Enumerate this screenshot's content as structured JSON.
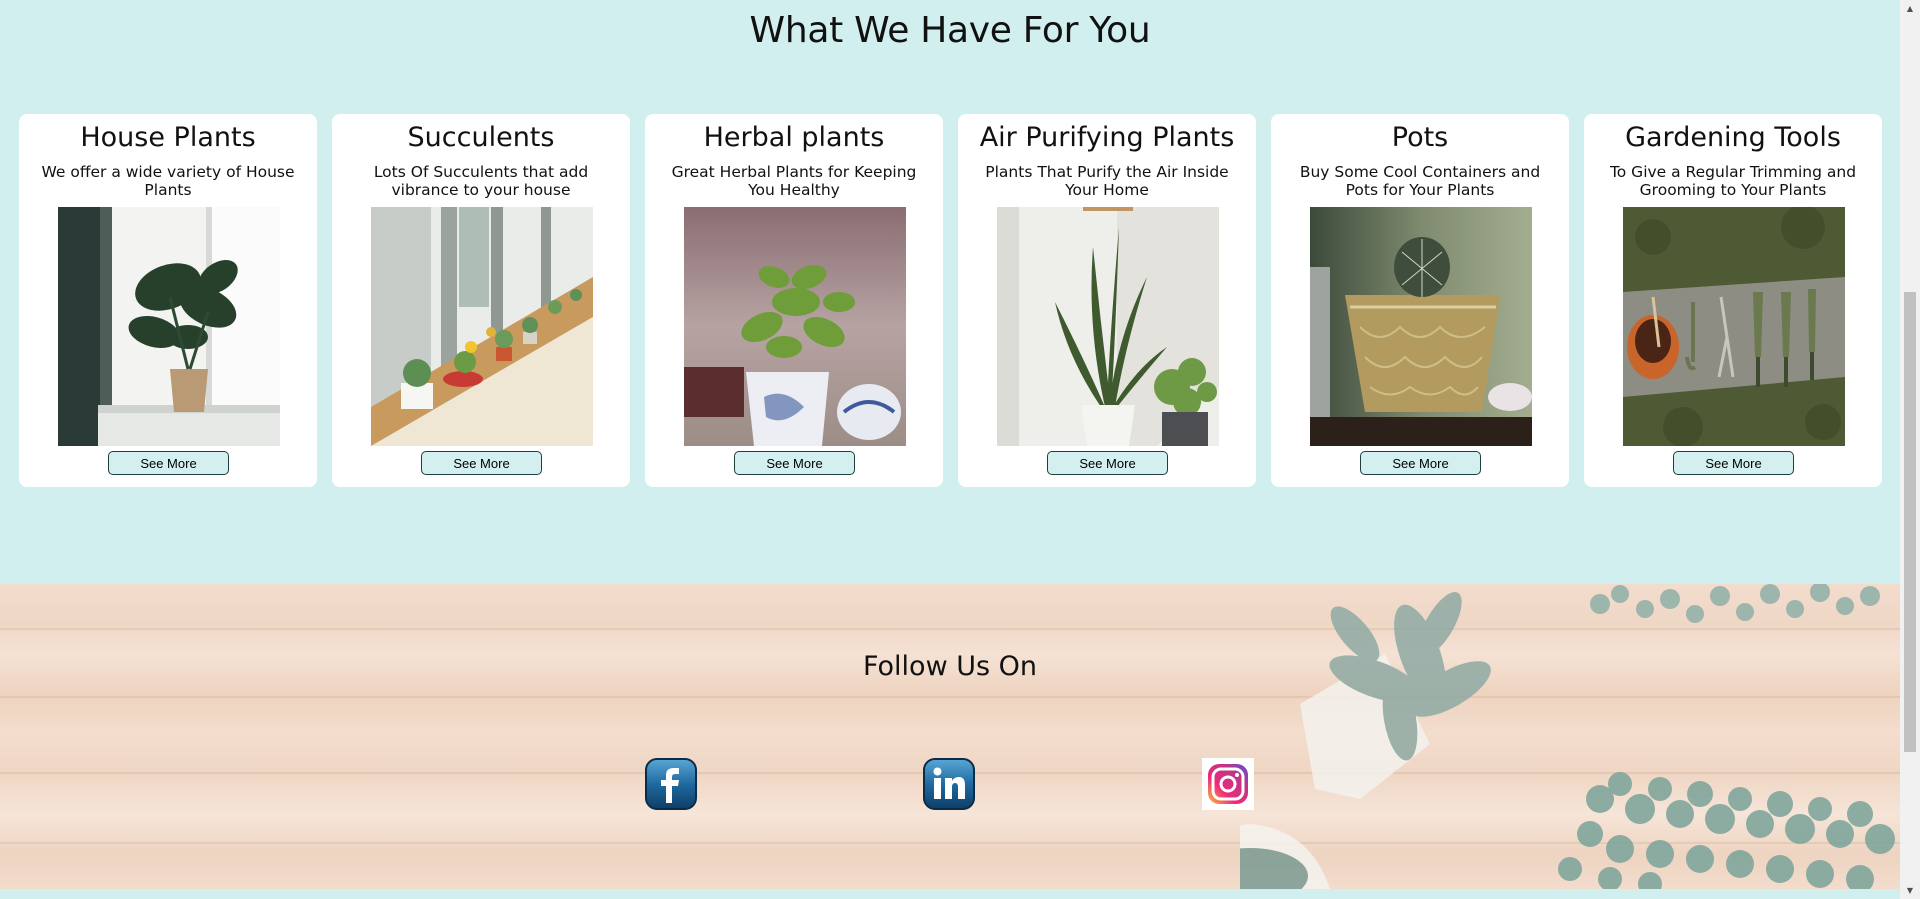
{
  "section": {
    "title": "What We Have For You"
  },
  "cards": [
    {
      "title": "House Plants",
      "desc": "We offer a wide variety of House Plants",
      "button": "See More"
    },
    {
      "title": "Succulents",
      "desc": "Lots Of Succulents that add vibrance to your house",
      "button": "See More"
    },
    {
      "title": "Herbal plants",
      "desc": "Great Herbal Plants for Keeping You Healthy",
      "button": "See More"
    },
    {
      "title": "Air Purifying Plants",
      "desc": "Plants That Purify the Air Inside Your Home",
      "button": "See More"
    },
    {
      "title": "Pots",
      "desc": "Buy Some Cool Containers and Pots for Your Plants",
      "button": "See More"
    },
    {
      "title": "Gardening Tools",
      "desc": "To Give a Regular Trimming and Grooming to Your Plants",
      "button": "See More"
    }
  ],
  "footer": {
    "title": "Follow Us On",
    "social": [
      {
        "name": "facebook-icon"
      },
      {
        "name": "linkedin-icon"
      },
      {
        "name": "instagram-icon"
      }
    ]
  },
  "colors": {
    "background": "#d1efef",
    "card": "#ffffff",
    "button": "#d4efef",
    "button_border": "#1f3f3f"
  }
}
